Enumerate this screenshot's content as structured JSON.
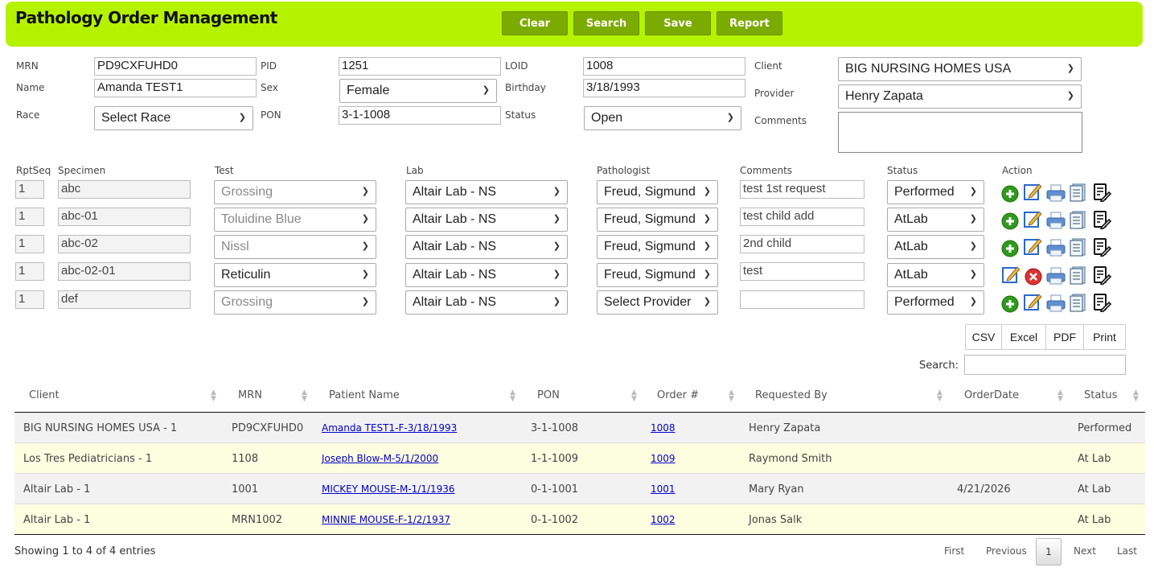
{
  "header": {
    "title": "Pathology Order Management",
    "buttons": [
      "Clear",
      "Search",
      "Save",
      "Report"
    ]
  },
  "form": {
    "mrn_label": "MRN",
    "mrn": "PD9CXFUHD0",
    "pid_label": "PID",
    "pid": "1251",
    "loid_label": "LOID",
    "loid": "1008",
    "client_label": "Client",
    "client": "BIG NURSING HOMES USA",
    "name_label": "Name",
    "name": "Amanda TEST1",
    "sex_label": "Sex",
    "sex": "Female",
    "birthday_label": "Birthday",
    "birthday": "3/18/1993",
    "provider_label": "Provider",
    "provider": "Henry Zapata",
    "race_label": "Race",
    "race": "Select Race",
    "pon_label": "PON",
    "pon": "3-1-1008",
    "status_label": "Status",
    "status": "Open",
    "comments_label": "Comments",
    "comments": ""
  },
  "specimens": {
    "headers": [
      "RptSeq",
      "Specimen",
      "Test",
      "Lab",
      "Pathologist",
      "Comments",
      "Status",
      "Action"
    ],
    "rows": [
      {
        "seq": "1",
        "specimen": "abc",
        "test": "Grossing",
        "lab": "Altair Lab - NS",
        "pathologist": "Freud, Sigmund",
        "comments": "test 1st request",
        "status": "Performed"
      },
      {
        "seq": "1",
        "specimen": "abc-01",
        "test": "Toluidine Blue",
        "lab": "Altair Lab - NS",
        "pathologist": "Freud, Sigmund",
        "comments": "test child add",
        "status": "AtLab"
      },
      {
        "seq": "1",
        "specimen": "abc-02",
        "test": "Nissl",
        "lab": "Altair Lab - NS",
        "pathologist": "Freud, Sigmund",
        "comments": "2nd child",
        "status": "AtLab"
      },
      {
        "seq": "1",
        "specimen": "abc-02-01",
        "test": "Reticulin",
        "lab": "Altair Lab - NS",
        "pathologist": "Freud, Sigmund",
        "comments": "test",
        "status": "AtLab"
      },
      {
        "seq": "1",
        "specimen": "def",
        "test": "Grossing",
        "lab": "Altair Lab - NS",
        "pathologist": "Select Provider",
        "comments": "",
        "status": "Performed"
      }
    ]
  },
  "export": {
    "buttons": [
      "CSV",
      "Excel",
      "PDF",
      "Print"
    ],
    "search_label": "Search:",
    "search_value": ""
  },
  "table": {
    "headers": [
      "Client",
      "MRN",
      "Patient Name",
      "PON",
      "Order #",
      "Requested By",
      "OrderDate",
      "Status"
    ],
    "rows": [
      {
        "client": "BIG NURSING HOMES USA - 1",
        "mrn": "PD9CXFUHD0",
        "patient": "Amanda TEST1-F-3/18/1993",
        "pon": "3-1-1008",
        "order": "1008",
        "requested": "Henry Zapata",
        "date": "",
        "status": "Performed"
      },
      {
        "client": "Los Tres Pediatricians - 1",
        "mrn": "1108",
        "patient": "Joseph Blow-M-5/1/2000",
        "pon": "1-1-1009",
        "order": "1009",
        "requested": "Raymond Smith",
        "date": "",
        "status": "At Lab"
      },
      {
        "client": "Altair Lab - 1",
        "mrn": "1001",
        "patient": "MICKEY MOUSE-M-1/1/1936",
        "pon": "0-1-1001",
        "order": "1001",
        "requested": "Mary Ryan",
        "date": "4/21/2026",
        "status": "At Lab"
      },
      {
        "client": "Altair Lab - 1",
        "mrn": "MRN1002",
        "patient": "MINNIE MOUSE-F-1/2/1937",
        "pon": "0-1-1002",
        "order": "1002",
        "requested": "Jonas Salk",
        "date": "",
        "status": "At Lab"
      }
    ]
  },
  "footer": {
    "info": "Showing 1 to 4 of 4 entries",
    "pagination": [
      "First",
      "Previous",
      "1",
      "Next",
      "Last"
    ]
  }
}
